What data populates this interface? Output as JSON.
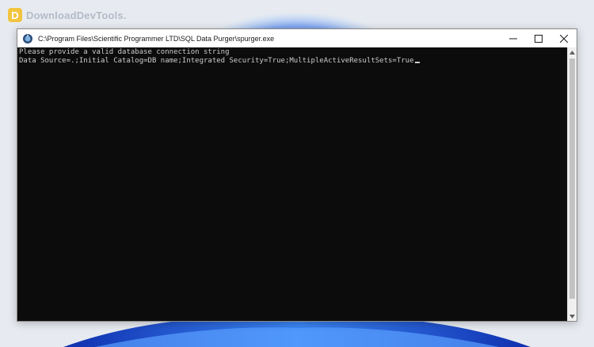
{
  "watermark": {
    "text": "DownloadDevTools.",
    "logo_letter": "D"
  },
  "window": {
    "title": "C:\\Program Files\\Scientific Programmer LTD\\SQL Data Purger\\spurger.exe",
    "icon": "console-app-icon",
    "minimize_icon": "minimize-icon",
    "maximize_icon": "maximize-icon",
    "close_icon": "close-icon"
  },
  "console": {
    "lines": [
      "Please provide a valid database connection string",
      "Data Source=.;Initial Catalog=DB name;Integrated Security=True;MultipleActiveResultSets=True"
    ],
    "text_color": "#cccccc",
    "background_color": "#0c0c0c"
  },
  "scrollbar": {
    "up_icon": "scroll-up-icon",
    "down_icon": "scroll-down-icon"
  }
}
